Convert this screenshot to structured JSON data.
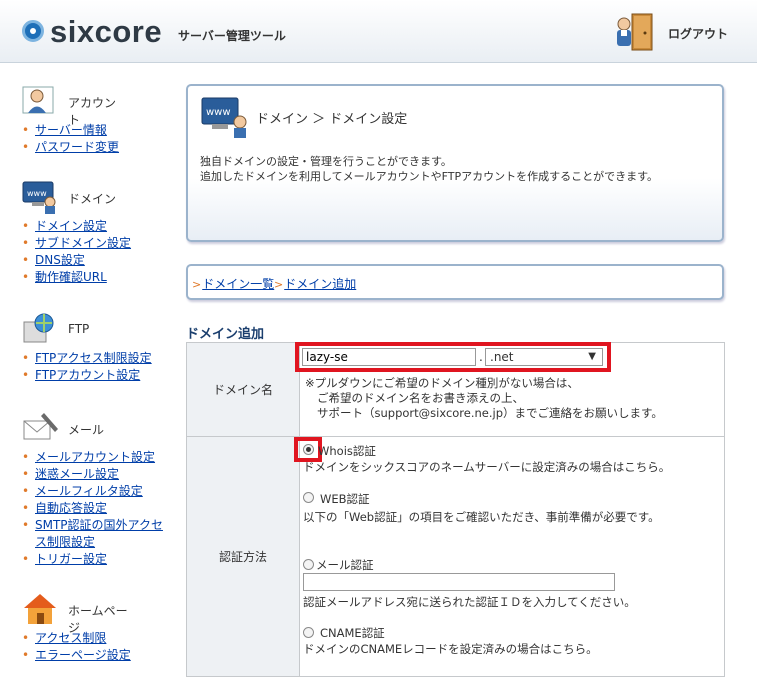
{
  "header": {
    "brand": "sixcore",
    "subtitle": "サーバー管理ツール",
    "logout_label": "ログアウト"
  },
  "sidebar": {
    "sections": [
      {
        "title": "アカウント",
        "icon": "user-icon",
        "items": [
          "サーバー情報",
          "パスワード変更"
        ]
      },
      {
        "title": "ドメイン",
        "icon": "www-monitor-icon",
        "items": [
          "ドメイン設定",
          "サブドメイン設定",
          "DNS設定",
          "動作確認URL"
        ]
      },
      {
        "title": "FTP",
        "icon": "globe-computer-icon",
        "items": [
          "FTPアクセス制限設定",
          "FTPアカウント設定"
        ]
      },
      {
        "title": "メール",
        "icon": "mail-icon",
        "items": [
          "メールアカウント設定",
          "迷惑メール設定",
          "メールフィルタ設定",
          "自動応答設定",
          "SMTP認証の国外アクセス制限設定",
          "トリガー設定"
        ]
      },
      {
        "title": "ホームページ",
        "icon": "house-icon",
        "items": [
          "アクセス制限",
          "エラーページ設定"
        ]
      }
    ]
  },
  "page": {
    "breadcrumb_title": "ドメイン ＞ ドメイン設定",
    "description_line1": "独自ドメインの設定・管理を行うことができます。",
    "description_line2": "追加したドメインを利用してメールアカウントやFTPアカウントを作成することができます。",
    "crumbs": [
      "ドメイン一覧",
      "ドメイン追加"
    ],
    "section_title": "ドメイン追加"
  },
  "form": {
    "domain_label": "ドメイン名",
    "domain_value": "lazy-se",
    "dot": ".",
    "tld_selected": ".net",
    "note_line1": "※プルダウンにご希望のドメイン種別がない場合は、",
    "note_line2": "ご希望のドメイン名をお書き添えの上、",
    "note_line3": "サポート（support@sixcore.ne.jp）までご連絡をお願いします。",
    "auth_label": "認証方法",
    "auth_options": [
      {
        "label": "Whois認証",
        "desc": "ドメインをシックスコアのネームサーバーに設定済みの場合はこちら。",
        "selected": true
      },
      {
        "label": "WEB認証",
        "desc": "以下の「Web認証」の項目をご確認いただき、事前準備が必要です。",
        "selected": false
      },
      {
        "label": "メール認証",
        "desc": "認証メールアドレス宛に送られた認証ＩＤを入力してください。",
        "selected": false
      },
      {
        "label": "CNAME認証",
        "desc": "ドメインのCNAMEレコードを設定済みの場合はこちら。",
        "selected": false
      }
    ]
  },
  "colors": {
    "link": "#003ea8",
    "highlight_red": "#e01520",
    "panel_border": "#9bb3cc",
    "section_title": "#1b3f6e"
  }
}
